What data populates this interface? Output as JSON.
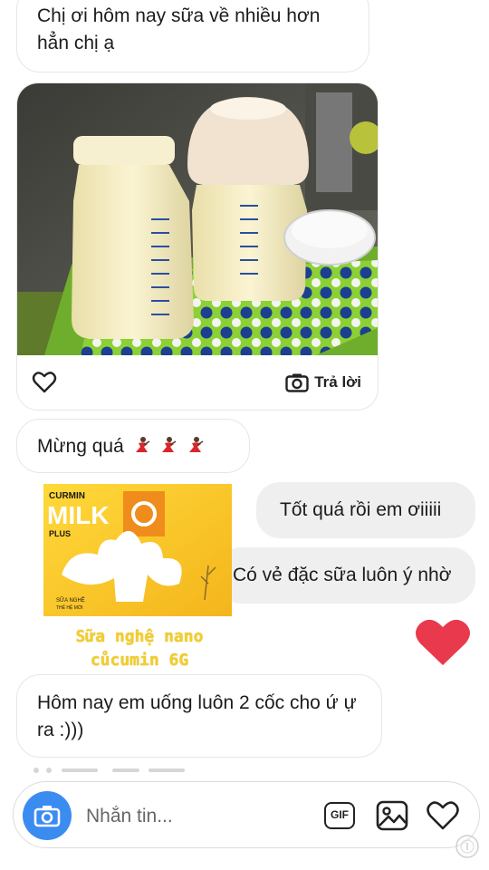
{
  "messages": {
    "msg1": "Chị ơi hôm nay sữa về nhiều hơn hẳn chị ạ",
    "msg2": "Mừng quá",
    "msg3": "Tốt quá rồi em ơiiiii",
    "msg4": "Có vẻ đặc sữa luôn ý nhờ",
    "msg5": "Hôm nay em uống luôn 2 cốc cho ứ ự ra :)))"
  },
  "photo_card": {
    "reply_label": "Trả lời",
    "like_icon": "heart-outline-icon",
    "reply_icon": "camera-icon"
  },
  "sticker": {
    "brand_top": "CURMIN",
    "brand_main": "MILK",
    "brand_sub": "PLUS",
    "pack_label_1": "SỮA NGHỆ",
    "pack_label_2": "THẾ HỆ MỚI",
    "caption_line1": "Sữa nghệ nano",
    "caption_line2": "cůcumin 6G"
  },
  "reaction": {
    "icon": "red-heart-icon",
    "color": "#e8394d"
  },
  "composer": {
    "placeholder": "Nhắn tin...",
    "gif_label": "GIF",
    "camera_color": "#3b8cf0"
  },
  "colors": {
    "incoming_border": "#e6e6e6",
    "outgoing_bg": "#efefef",
    "caption_yellow": "#f3cd2c"
  }
}
